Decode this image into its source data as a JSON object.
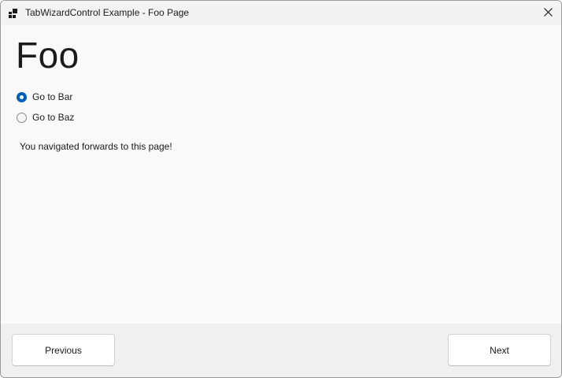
{
  "window": {
    "title": "TabWizardControl Example - Foo Page",
    "app_icon": "app-icon",
    "close_icon": "close-icon"
  },
  "page": {
    "heading": "Foo",
    "options": [
      {
        "label": "Go to Bar",
        "selected": true
      },
      {
        "label": "Go to Baz",
        "selected": false
      }
    ],
    "message": "You navigated forwards to this page!"
  },
  "footer": {
    "previous_label": "Previous",
    "next_label": "Next"
  },
  "colors": {
    "accent": "#005fb8",
    "content_bg": "#f9f9f9",
    "footer_bg": "#f0f0f0"
  }
}
